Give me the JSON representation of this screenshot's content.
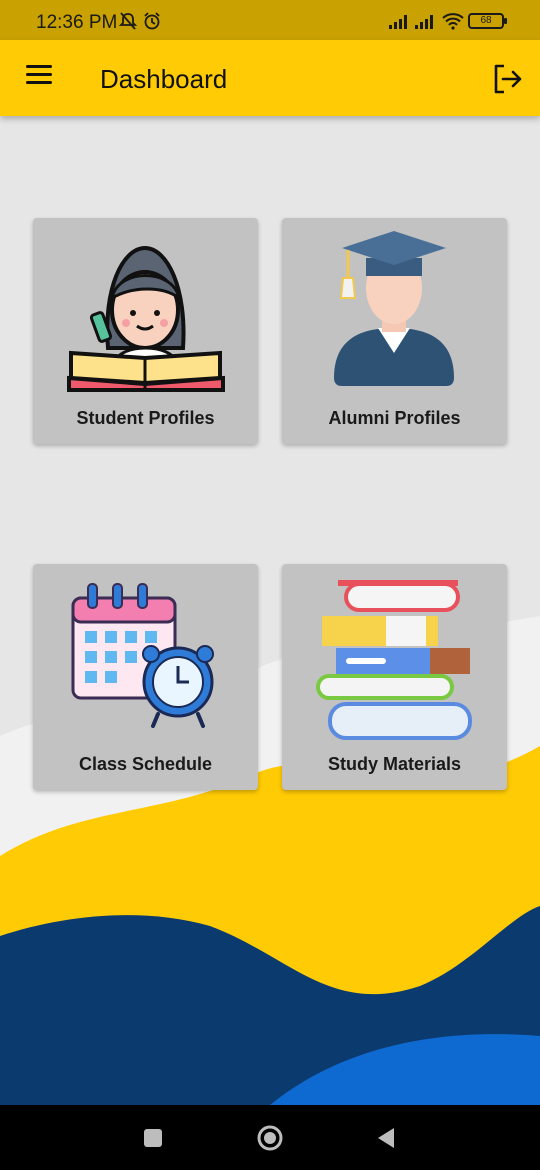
{
  "status_bar": {
    "time": "12:36 PM",
    "battery": "68",
    "icons": [
      "notifications-off-icon",
      "alarm-icon",
      "signal-icon",
      "signal-icon",
      "wifi-icon",
      "battery-icon"
    ]
  },
  "app_bar": {
    "title": "Dashboard",
    "menu_icon": "hamburger-menu-icon",
    "logout_icon": "logout-icon"
  },
  "cards": [
    {
      "label": "Student Profiles",
      "icon": "student-reading-icon"
    },
    {
      "label": "Alumni Profiles",
      "icon": "graduate-icon"
    },
    {
      "label": "Class Schedule",
      "icon": "calendar-clock-icon"
    },
    {
      "label": "Study Materials",
      "icon": "books-stack-icon"
    }
  ],
  "nav_bar": {
    "icons": [
      "recents-square-icon",
      "home-circle-icon",
      "back-triangle-icon"
    ]
  },
  "colors": {
    "app_bar": "#ffcb05",
    "status_bar": "#c9a100",
    "background": "#e6e6e6",
    "card": "#c2c2c2",
    "wave_yellow": "#ffcb05",
    "wave_navy": "#0b3a6e",
    "wave_blue": "#0e6ad0"
  }
}
